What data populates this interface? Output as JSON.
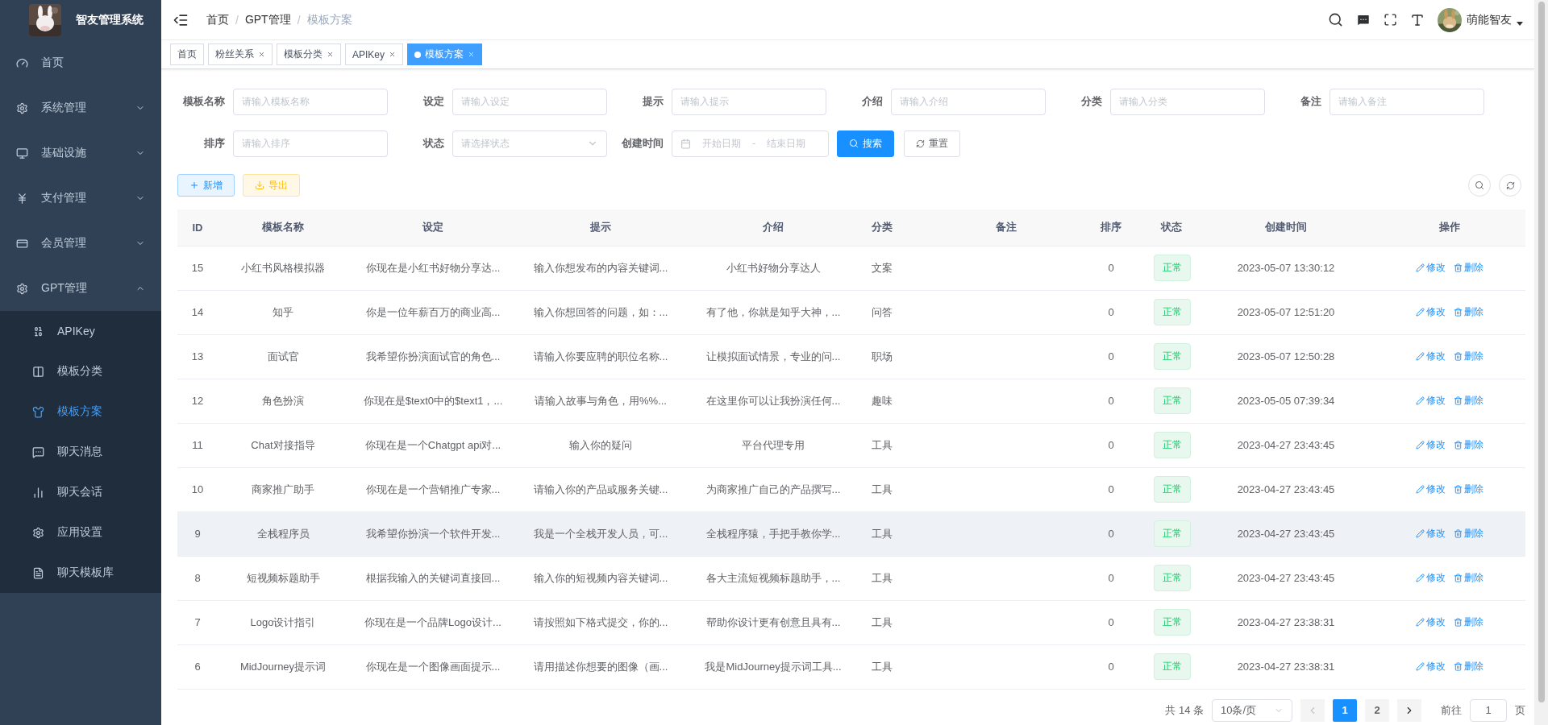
{
  "sidebar": {
    "title": "智友管理系统",
    "items": [
      {
        "label": "首页",
        "selected": false
      },
      {
        "label": "系统管理",
        "selected": false,
        "expanded": false
      },
      {
        "label": "基础设施",
        "selected": false,
        "expanded": false
      },
      {
        "label": "支付管理",
        "selected": false,
        "expanded": false
      },
      {
        "label": "会员管理",
        "selected": false,
        "expanded": false
      },
      {
        "label": "GPT管理",
        "selected": false,
        "expanded": true,
        "children": [
          {
            "label": "APIKey",
            "selected": false
          },
          {
            "label": "模板分类",
            "selected": false
          },
          {
            "label": "模板方案",
            "selected": true
          },
          {
            "label": "聊天消息",
            "selected": false
          },
          {
            "label": "聊天会话",
            "selected": false
          },
          {
            "label": "应用设置",
            "selected": false
          },
          {
            "label": "聊天模板库",
            "selected": false
          }
        ]
      }
    ]
  },
  "breadcrumb": {
    "separator": "/",
    "items": [
      "首页",
      "GPT管理",
      "模板方案"
    ]
  },
  "user": {
    "name": "萌能智友"
  },
  "tabs": [
    {
      "label": "首页",
      "selected": false,
      "closable": false
    },
    {
      "label": "粉丝关系",
      "selected": false,
      "closable": true
    },
    {
      "label": "模板分类",
      "selected": false,
      "closable": true
    },
    {
      "label": "APIKey",
      "selected": false,
      "closable": true
    },
    {
      "label": "模板方案",
      "selected": true,
      "closable": true
    }
  ],
  "search_form": {
    "fields": [
      {
        "kind": "input",
        "label": "模板名称",
        "placeholder": "请输入模板名称"
      },
      {
        "kind": "input",
        "label": "设定",
        "placeholder": "请输入设定"
      },
      {
        "kind": "input",
        "label": "提示",
        "placeholder": "请输入提示"
      },
      {
        "kind": "input",
        "label": "介绍",
        "placeholder": "请输入介绍"
      },
      {
        "kind": "input",
        "label": "分类",
        "placeholder": "请输入分类"
      },
      {
        "kind": "input",
        "label": "备注",
        "placeholder": "请输入备注"
      },
      {
        "kind": "input",
        "label": "排序",
        "placeholder": "请输入排序"
      },
      {
        "kind": "select",
        "label": "状态",
        "placeholder": "请选择状态"
      },
      {
        "kind": "daterange",
        "label": "创建时间",
        "start_placeholder": "开始日期",
        "separator": "-",
        "end_placeholder": "结束日期"
      }
    ],
    "search_button": "搜索",
    "reset_button": "重置"
  },
  "toolbar": [
    {
      "kind": "primary",
      "label": "新增"
    },
    {
      "kind": "warning",
      "label": "导出"
    }
  ],
  "table": {
    "columns": [
      "ID",
      "模板名称",
      "设定",
      "提示",
      "介绍",
      "分类",
      "备注",
      "排序",
      "状态",
      "创建时间",
      "操作"
    ],
    "rows": [
      {
        "id": "15",
        "name": "小红书风格模拟器",
        "setting": "你现在是小红书好物分享达...",
        "prompt": "输入你想发布的内容关键词...",
        "intro": "小红书好物分享达人",
        "category": "文案",
        "sort": "0",
        "status": "正常",
        "created": "2023-05-07 13:30:12",
        "actions": [
          "修改",
          "删除"
        ],
        "hovered": false
      },
      {
        "id": "14",
        "name": "知乎",
        "setting": "你是一位年薪百万的商业高...",
        "prompt": "输入你想回答的问题，如：...",
        "intro": "有了他，你就是知乎大神，...",
        "category": "问答",
        "sort": "0",
        "status": "正常",
        "created": "2023-05-07 12:51:20",
        "actions": [
          "修改",
          "删除"
        ],
        "hovered": false
      },
      {
        "id": "13",
        "name": "面试官",
        "setting": "我希望你扮演面试官的角色...",
        "prompt": "请输入你要应聘的职位名称...",
        "intro": "让模拟面试情景，专业的问...",
        "category": "职场",
        "sort": "0",
        "status": "正常",
        "created": "2023-05-07 12:50:28",
        "actions": [
          "修改",
          "删除"
        ],
        "hovered": false
      },
      {
        "id": "12",
        "name": "角色扮演",
        "setting": "你现在是$text0中的$text1，...",
        "prompt": "请输入故事与角色，用%%...",
        "intro": "在这里你可以让我扮演任何...",
        "category": "趣味",
        "sort": "0",
        "status": "正常",
        "created": "2023-05-05 07:39:34",
        "actions": [
          "修改",
          "删除"
        ],
        "hovered": false
      },
      {
        "id": "11",
        "name": "Chat对接指导",
        "setting": "你现在是一个Chatgpt api对...",
        "prompt": "输入你的疑问",
        "intro": "平台代理专用",
        "category": "工具",
        "sort": "0",
        "status": "正常",
        "created": "2023-04-27 23:43:45",
        "actions": [
          "修改",
          "删除"
        ],
        "hovered": false
      },
      {
        "id": "10",
        "name": "商家推广助手",
        "setting": "你现在是一个营销推广专家...",
        "prompt": "请输入你的产品或服务关键...",
        "intro": "为商家推广自己的产品撰写...",
        "category": "工具",
        "sort": "0",
        "status": "正常",
        "created": "2023-04-27 23:43:45",
        "actions": [
          "修改",
          "删除"
        ],
        "hovered": false
      },
      {
        "id": "9",
        "name": "全栈程序员",
        "setting": "我希望你扮演一个软件开发...",
        "prompt": "我是一个全栈开发人员，可...",
        "intro": "全栈程序猿，手把手教你学...",
        "category": "工具",
        "sort": "0",
        "status": "正常",
        "created": "2023-04-27 23:43:45",
        "actions": [
          "修改",
          "删除"
        ],
        "hovered": true
      },
      {
        "id": "8",
        "name": "短视频标题助手",
        "setting": "根据我输入的关键词直接回...",
        "prompt": "输入你的短视频内容关键词...",
        "intro": "各大主流短视频标题助手，...",
        "category": "工具",
        "sort": "0",
        "status": "正常",
        "created": "2023-04-27 23:43:45",
        "actions": [
          "修改",
          "删除"
        ],
        "hovered": false
      },
      {
        "id": "7",
        "name": "Logo设计指引",
        "setting": "你现在是一个品牌Logo设计...",
        "prompt": "请按照如下格式提交，你的...",
        "intro": "帮助你设计更有创意且具有...",
        "category": "工具",
        "sort": "0",
        "status": "正常",
        "created": "2023-04-27 23:38:31",
        "actions": [
          "修改",
          "删除"
        ],
        "hovered": false
      },
      {
        "id": "6",
        "name": "MidJourney提示词",
        "setting": "你现在是一个图像画面提示...",
        "prompt": "请用描述你想要的图像（画...",
        "intro": "我是MidJourney提示词工具...",
        "category": "工具",
        "sort": "0",
        "status": "正常",
        "created": "2023-04-27 23:38:31",
        "actions": [
          "修改",
          "删除"
        ],
        "hovered": false
      }
    ]
  },
  "pagination": {
    "total": "共 14 条",
    "page_size": "10条/页",
    "pages": [
      {
        "label": "1",
        "selected": true
      },
      {
        "label": "2",
        "selected": false
      }
    ],
    "goto_label": "前往",
    "goto_value": "1",
    "goto_suffix": "页"
  }
}
